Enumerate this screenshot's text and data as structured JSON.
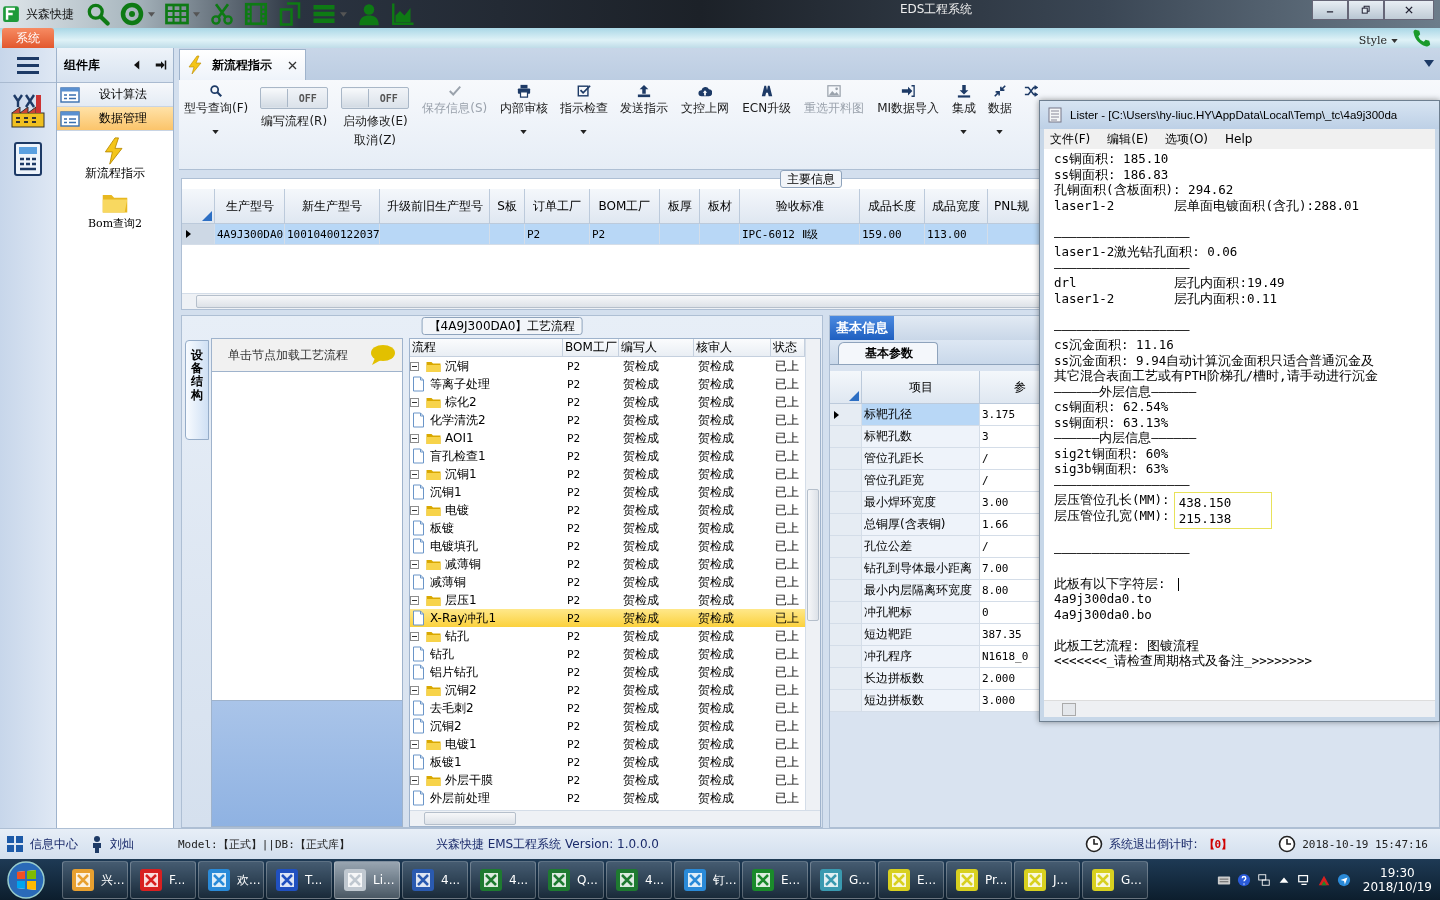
{
  "title_bar": {
    "app_name": "兴森快捷",
    "title": "EDS工程系统"
  },
  "ribbon": {
    "tabs": [
      {
        "label": "系统",
        "selected": true
      }
    ],
    "style_label": "Style"
  },
  "sidebar": {
    "header": "组件库",
    "items": [
      {
        "label": "设计算法",
        "selected": false
      },
      {
        "label": "数据管理",
        "selected": true
      }
    ],
    "tools": [
      {
        "kind": "bolt",
        "label": "新流程指示"
      },
      {
        "kind": "folder",
        "label": "Bom查询2"
      }
    ]
  },
  "doc_tabs": [
    {
      "label": "新流程指示",
      "selected": true
    }
  ],
  "toolbar": [
    {
      "kind": "split",
      "label": "型号查询(F)",
      "disabled": false
    },
    {
      "kind": "toggle",
      "label": "编写流程(R)",
      "switch_text": "OFF",
      "on": false,
      "disabled": false
    },
    {
      "kind": "toggle",
      "label": "启动修改(E)",
      "sublabel": "取消(Z)",
      "switch_text": "OFF",
      "on": false,
      "disabled": false
    },
    {
      "kind": "button",
      "label": "保存信息(S)",
      "disabled": true
    },
    {
      "kind": "split",
      "label": "内部审核",
      "disabled": false
    },
    {
      "kind": "split",
      "label": "指示检查",
      "disabled": false
    },
    {
      "kind": "button",
      "label": "发送指示",
      "disabled": false
    },
    {
      "kind": "button",
      "label": "文控上网",
      "disabled": false
    },
    {
      "kind": "button",
      "label": "ECN升级",
      "disabled": false
    },
    {
      "kind": "button",
      "label": "重选开料图",
      "disabled": true
    },
    {
      "kind": "button",
      "label": "MI数据导入",
      "disabled": false
    },
    {
      "kind": "split",
      "label": "集成",
      "disabled": false
    },
    {
      "kind": "split",
      "label": "数据",
      "disabled": false
    },
    {
      "kind": "icon",
      "disabled": false
    }
  ],
  "main_info": {
    "legend": "主要信息",
    "columns": [
      "生产型号",
      "新生产型号",
      "升级前旧生产型号",
      "S板",
      "订单工厂",
      "BOM工厂",
      "板厚",
      "板材",
      "验收标准",
      "成品长度",
      "成品宽度",
      "PNL规"
    ],
    "rows": [
      {
        "selected": true,
        "cells": [
          "4A9J300DA0",
          "10010400122037",
          null,
          null,
          "P2",
          "P2",
          null,
          null,
          "IPC-6012 Ⅱ级",
          "159.00",
          "113.00",
          null
        ]
      }
    ]
  },
  "flow": {
    "legend": "【4A9J300DA0】工艺流程",
    "side_tab": "设备结构",
    "hint": "单击节点加载工艺流程",
    "columns": [
      "流程",
      "BOM工厂",
      "编写人",
      "核审人",
      "状态"
    ],
    "tree": [
      {
        "name": "沉铜",
        "bom": "P2",
        "writer": "贺检成",
        "reviewer": "贺检成",
        "status": "已上",
        "expanded": true,
        "selected": false,
        "children": [
          {
            "name": "等离子处理",
            "bom": "P2",
            "writer": "贺检成",
            "reviewer": "贺检成",
            "status": "已上",
            "selected": false
          }
        ]
      },
      {
        "name": "棕化2",
        "bom": "P2",
        "writer": "贺检成",
        "reviewer": "贺检成",
        "status": "已上",
        "expanded": true,
        "selected": false,
        "children": [
          {
            "name": "化学清洗2",
            "bom": "P2",
            "writer": "贺检成",
            "reviewer": "贺检成",
            "status": "已上",
            "selected": false
          }
        ]
      },
      {
        "name": "AOI1",
        "bom": "P2",
        "writer": "贺检成",
        "reviewer": "贺检成",
        "status": "已上",
        "expanded": true,
        "selected": false,
        "children": [
          {
            "name": "盲孔检查1",
            "bom": "P2",
            "writer": "贺检成",
            "reviewer": "贺检成",
            "status": "已上",
            "selected": false
          }
        ]
      },
      {
        "name": "沉铜1",
        "bom": "P2",
        "writer": "贺检成",
        "reviewer": "贺检成",
        "status": "已上",
        "expanded": true,
        "selected": false,
        "children": [
          {
            "name": "沉铜1",
            "bom": "P2",
            "writer": "贺检成",
            "reviewer": "贺检成",
            "status": "已上",
            "selected": false
          }
        ]
      },
      {
        "name": "电镀",
        "bom": "P2",
        "writer": "贺检成",
        "reviewer": "贺检成",
        "status": "已上",
        "expanded": true,
        "selected": false,
        "children": [
          {
            "name": "板镀",
            "bom": "P2",
            "writer": "贺检成",
            "reviewer": "贺检成",
            "status": "已上",
            "selected": false
          },
          {
            "name": "电镀填孔",
            "bom": "P2",
            "writer": "贺检成",
            "reviewer": "贺检成",
            "status": "已上",
            "selected": false
          }
        ]
      },
      {
        "name": "减薄铜",
        "bom": "P2",
        "writer": "贺检成",
        "reviewer": "贺检成",
        "status": "已上",
        "expanded": true,
        "selected": false,
        "children": [
          {
            "name": "减薄铜",
            "bom": "P2",
            "writer": "贺检成",
            "reviewer": "贺检成",
            "status": "已上",
            "selected": false
          }
        ]
      },
      {
        "name": "层压1",
        "bom": "P2",
        "writer": "贺检成",
        "reviewer": "贺检成",
        "status": "已上",
        "expanded": true,
        "selected": false,
        "children": [
          {
            "name": "X-Ray冲孔1",
            "bom": "P2",
            "writer": "贺检成",
            "reviewer": "贺检成",
            "status": "已上",
            "selected": true
          }
        ]
      },
      {
        "name": "钻孔",
        "bom": "P2",
        "writer": "贺检成",
        "reviewer": "贺检成",
        "status": "已上",
        "expanded": true,
        "selected": false,
        "children": [
          {
            "name": "钻孔",
            "bom": "P2",
            "writer": "贺检成",
            "reviewer": "贺检成",
            "status": "已上",
            "selected": false
          },
          {
            "name": "铝片钻孔",
            "bom": "P2",
            "writer": "贺检成",
            "reviewer": "贺检成",
            "status": "已上",
            "selected": false
          }
        ]
      },
      {
        "name": "沉铜2",
        "bom": "P2",
        "writer": "贺检成",
        "reviewer": "贺检成",
        "status": "已上",
        "expanded": true,
        "selected": false,
        "children": [
          {
            "name": "去毛刺2",
            "bom": "P2",
            "writer": "贺检成",
            "reviewer": "贺检成",
            "status": "已上",
            "selected": false
          },
          {
            "name": "沉铜2",
            "bom": "P2",
            "writer": "贺检成",
            "reviewer": "贺检成",
            "status": "已上",
            "selected": false
          }
        ]
      },
      {
        "name": "电镀1",
        "bom": "P2",
        "writer": "贺检成",
        "reviewer": "贺检成",
        "status": "已上",
        "expanded": true,
        "selected": false,
        "children": [
          {
            "name": "板镀1",
            "bom": "P2",
            "writer": "贺检成",
            "reviewer": "贺检成",
            "status": "已上",
            "selected": false
          }
        ]
      },
      {
        "name": "外层干膜",
        "bom": "P2",
        "writer": "贺检成",
        "reviewer": "贺检成",
        "status": "已上",
        "expanded": true,
        "selected": false,
        "children": [
          {
            "name": "外层前处理",
            "bom": "P2",
            "writer": "贺检成",
            "reviewer": "贺检成",
            "status": "已上",
            "selected": false
          }
        ]
      }
    ]
  },
  "basic": {
    "tab": "基本信息",
    "subtab": "基本参数",
    "columns": [
      "项目",
      "参"
    ],
    "rows": [
      {
        "item": "标靶孔径",
        "value": "3.175",
        "selected": true
      },
      {
        "item": "标靶孔数",
        "value": "3",
        "selected": false
      },
      {
        "item": "管位孔距长",
        "value": "/",
        "selected": false
      },
      {
        "item": "管位孔距宽",
        "value": "/",
        "selected": false
      },
      {
        "item": "最小焊环宽度",
        "value": "3.00",
        "selected": false
      },
      {
        "item": "总铜厚(含表铜)",
        "value": "1.66",
        "selected": false
      },
      {
        "item": "孔位公差",
        "value": "/",
        "selected": false
      },
      {
        "item": "钻孔到导体最小距离",
        "value": "7.00",
        "selected": false
      },
      {
        "item": "最小内层隔离环宽度",
        "value": "8.00",
        "selected": false
      },
      {
        "item": "冲孔靶标",
        "value": "0",
        "selected": false
      },
      {
        "item": "短边靶距",
        "value": "387.35",
        "selected": false
      },
      {
        "item": "冲孔程序",
        "value": "N1618_0",
        "selected": false
      },
      {
        "item": "长边拼板数",
        "value": "2.000",
        "selected": false
      },
      {
        "item": "短边拼板数",
        "value": "3.000",
        "selected": false
      }
    ]
  },
  "lister": {
    "title": "Lister - [C:\\Users\\hy-liuc.HY\\AppData\\Local\\Temp\\_tc\\4a9j300da",
    "menu": [
      "文件(F)",
      "编辑(E)",
      "选项(O)",
      "Help"
    ],
    "lines": [
      {
        "kind": "text",
        "text": "cs铜面积: 185.10"
      },
      {
        "kind": "text",
        "text": "ss铜面积: 186.83"
      },
      {
        "kind": "text",
        "text": "孔铜面积(含板面积): 294.62"
      },
      {
        "kind": "text",
        "text": "laser1-2        层单面电镀面积(含孔):288.01"
      },
      {
        "kind": "blank"
      },
      {
        "kind": "text",
        "text": "——————————————————"
      },
      {
        "kind": "text",
        "text": "laser1-2激光钻孔面积: 0.06"
      },
      {
        "kind": "text",
        "text": "——————————————————"
      },
      {
        "kind": "text",
        "text": "drl             层孔内面积:19.49"
      },
      {
        "kind": "text",
        "text": "laser1-2        层孔内面积:0.11"
      },
      {
        "kind": "blank"
      },
      {
        "kind": "text",
        "text": "——————————————————"
      },
      {
        "kind": "text",
        "text": "cs沉金面积: 11.16"
      },
      {
        "kind": "text",
        "text": "ss沉金面积: 9.94自动计算沉金面积只适合普通沉金及"
      },
      {
        "kind": "text",
        "text": "其它混合表面工艺或有PTH阶梯孔/槽时,请手动进行沉金"
      },
      {
        "kind": "text",
        "text": "——————外层信息——————"
      },
      {
        "kind": "text",
        "text": "cs铜面积: 62.54%"
      },
      {
        "kind": "text",
        "text": "ss铜面积: 63.13%"
      },
      {
        "kind": "text",
        "text": "——————内层信息——————"
      },
      {
        "kind": "text",
        "text": "sig2t铜面积: 60%"
      },
      {
        "kind": "text",
        "text": "sig3b铜面积: 63%"
      },
      {
        "kind": "text",
        "text": "——————————————————"
      },
      {
        "kind": "highlight",
        "labels": [
          "层压管位孔长(MM):",
          "层压管位孔宽(MM):"
        ],
        "values": [
          "438.150",
          "215.138"
        ]
      },
      {
        "kind": "blank"
      },
      {
        "kind": "text",
        "text": "——————————————————"
      },
      {
        "kind": "blank"
      },
      {
        "kind": "text",
        "text": "此板有以下字符层:",
        "cursor": true
      },
      {
        "kind": "text",
        "text": "4a9j300da0.to"
      },
      {
        "kind": "text",
        "text": "4a9j300da0.bo"
      },
      {
        "kind": "blank"
      },
      {
        "kind": "text",
        "text": "此板工艺流程: 图镀流程"
      },
      {
        "kind": "text",
        "text": "<<<<<<<_请检查周期格式及备注_>>>>>>>>"
      }
    ]
  },
  "status_bar": {
    "info_center": "信息中心",
    "user": "刘灿",
    "model": "Model:【正式】||DB:【正式库】",
    "version": "兴森快捷 EMS工程系统 Version: 1.0.0.0",
    "countdown_label": "系统退出倒计时:",
    "countdown": "【0】",
    "datetime": "2018-10-19 15:47:16"
  },
  "taskbar": {
    "items": [
      {
        "label": "兴...",
        "selected": false
      },
      {
        "label": "F...",
        "selected": false
      },
      {
        "label": "欢...",
        "selected": false
      },
      {
        "label": "T...",
        "selected": false
      },
      {
        "label": "Li...",
        "selected": true
      },
      {
        "label": "4...",
        "selected": false
      },
      {
        "label": "4...",
        "selected": false
      },
      {
        "label": "Q...",
        "selected": false
      },
      {
        "label": "4...",
        "selected": false
      },
      {
        "label": "钉...",
        "selected": false
      },
      {
        "label": "E...",
        "selected": false
      },
      {
        "label": "G...",
        "selected": false
      },
      {
        "label": "E...",
        "selected": false
      },
      {
        "label": "Pr...",
        "selected": false
      },
      {
        "label": "J...",
        "selected": false
      },
      {
        "label": "G...",
        "selected": false
      }
    ],
    "time": "19:30",
    "date": "2018/10/19"
  }
}
